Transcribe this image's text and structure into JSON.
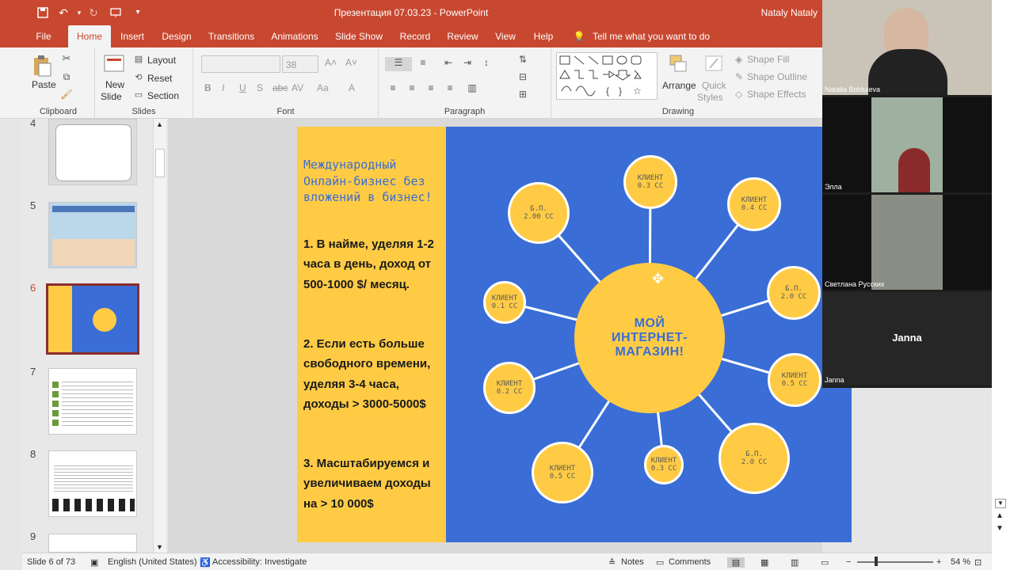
{
  "window": {
    "title": "Презентация 07.03.23  -  PowerPoint",
    "user": "Nataly Nataly"
  },
  "quick_access": [
    "save-icon",
    "undo-icon",
    "redo-icon",
    "present-icon",
    "customize-icon"
  ],
  "tabs": [
    "File",
    "Home",
    "Insert",
    "Design",
    "Transitions",
    "Animations",
    "Slide Show",
    "Record",
    "Review",
    "View",
    "Help"
  ],
  "tell_me": "Tell me what you want to do",
  "ribbon": {
    "clipboard": {
      "label": "Clipboard",
      "paste": "Paste"
    },
    "slides": {
      "label": "Slides",
      "new_slide_1": "New",
      "new_slide_2": "Slide",
      "layout": "Layout",
      "reset": "Reset",
      "section": "Section"
    },
    "font": {
      "label": "Font",
      "size": "38"
    },
    "paragraph": {
      "label": "Paragraph"
    },
    "drawing": {
      "label": "Drawing",
      "arrange": "Arrange",
      "quick_styles_1": "Quick",
      "quick_styles_2": "Styles",
      "shape_fill": "Shape Fill",
      "shape_outline": "Shape Outline",
      "shape_effects": "Shape Effects"
    }
  },
  "slides_panel": {
    "numbers": [
      "4",
      "5",
      "6",
      "7",
      "8",
      "9"
    ],
    "selected": "6"
  },
  "slide": {
    "title": "Международный Онлайн-бизнес без вложений в бизнес!",
    "p1": "1. В найме, уделяя 1-2 часа в день, доход от 500-1000 $/ месяц.",
    "p2": "2. Если есть больше свободного времени, уделяя 3-4 часа, доходы > 3000-5000$",
    "p3": "3. Масштабируемся и увеличиваем доходы на > 10 000$",
    "center": "МОЙ ИНТЕРНЕТ-МАГАЗИН!",
    "nodes": [
      {
        "l1": "КЛИЕНТ",
        "l2": "0.3 СС"
      },
      {
        "l1": "КЛИЕНТ",
        "l2": "0.4 СС"
      },
      {
        "l1": "Б.П.",
        "l2": "2.0 СС"
      },
      {
        "l1": "КЛИЕНТ",
        "l2": "0.5 СС"
      },
      {
        "l1": "Б.П.",
        "l2": "2.0 СС"
      },
      {
        "l1": "КЛИЕНТ",
        "l2": "0.3 СС"
      },
      {
        "l1": "КЛИЕНТ",
        "l2": "0.5 СС"
      },
      {
        "l1": "КЛИЕНТ",
        "l2": "0.2 СС"
      },
      {
        "l1": "КЛИЕНТ",
        "l2": "0.1 СС"
      },
      {
        "l1": "Б.П.",
        "l2": "2.00 СС"
      }
    ]
  },
  "participants": [
    {
      "name": "Natalia Bolduieva",
      "video": true
    },
    {
      "name": "Элла",
      "video": true
    },
    {
      "name": "Светлана Русских",
      "video": true
    },
    {
      "name": "Janna",
      "video": false
    }
  ],
  "status": {
    "slide_of": "Slide 6 of 73",
    "language": "English (United States)",
    "accessibility": "Accessibility: Investigate",
    "notes": "Notes",
    "comments": "Comments",
    "zoom": "54 %"
  }
}
